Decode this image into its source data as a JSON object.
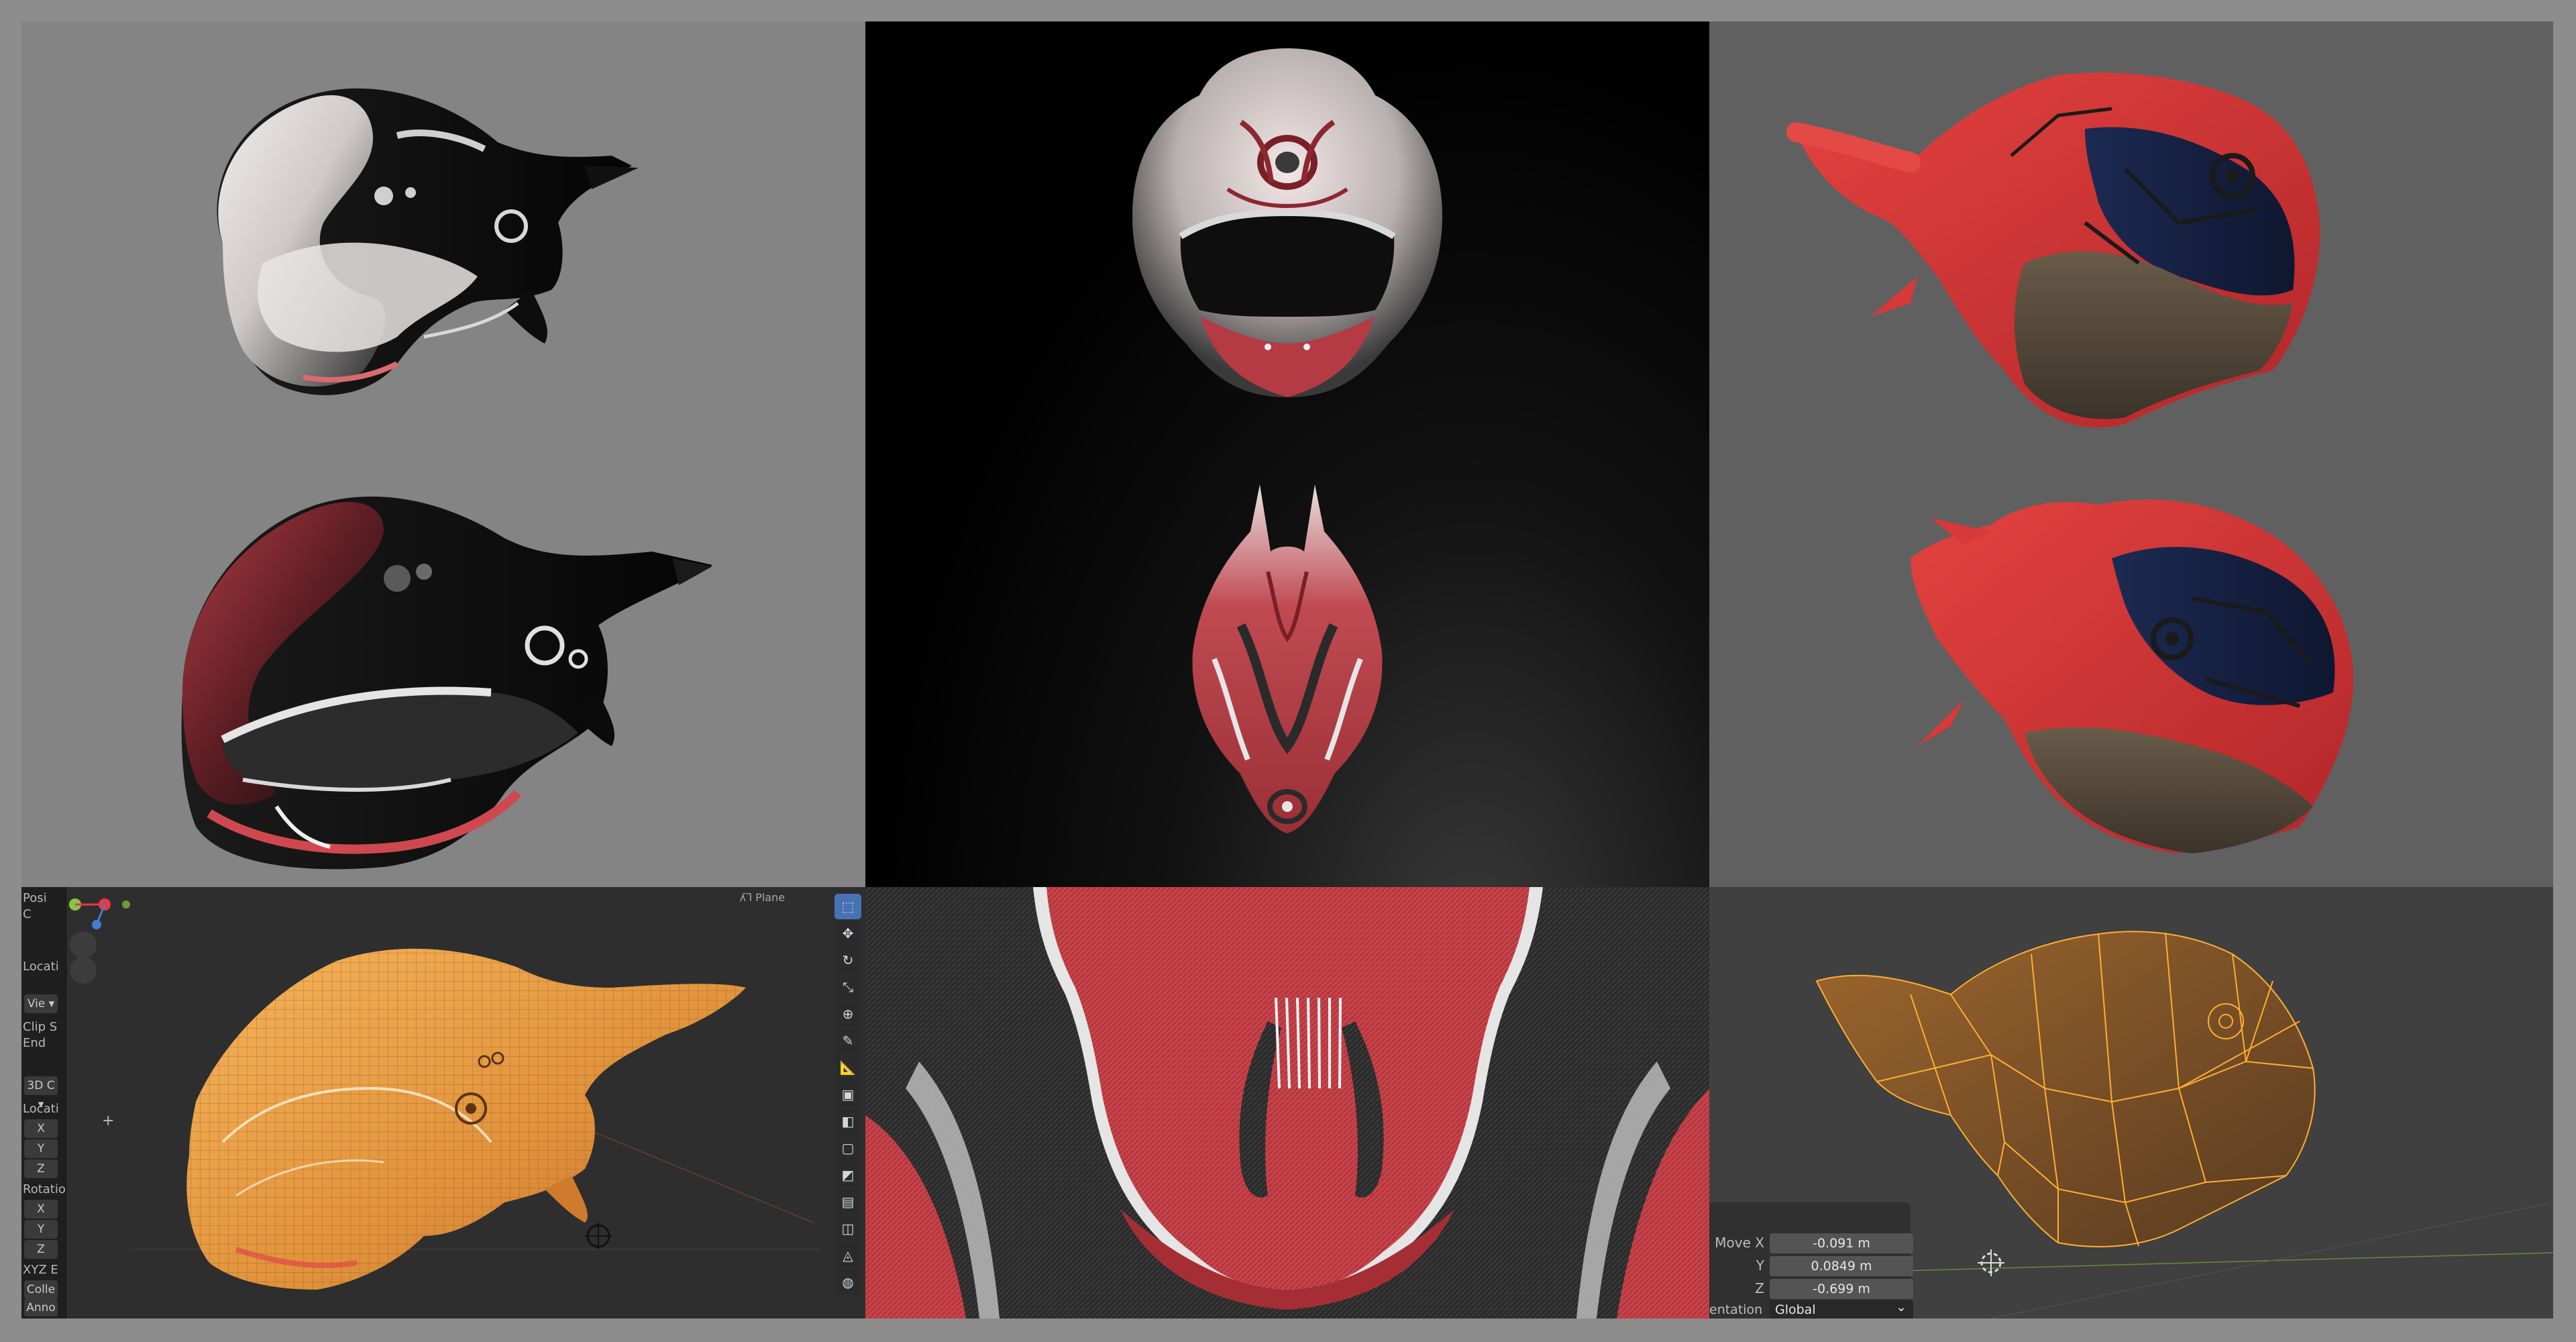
{
  "blender_panel": {
    "header": "ʎ⅂ Plane",
    "left_strip": [
      {
        "type": "text",
        "label": "Posi"
      },
      {
        "type": "text",
        "label": "C"
      },
      {
        "type": "text",
        "label": "Locati"
      },
      {
        "type": "box",
        "label": "Vie ▾"
      },
      {
        "type": "text",
        "label": "Clip S"
      },
      {
        "type": "text",
        "label": "End"
      },
      {
        "type": "box",
        "label": "3D C ▾"
      },
      {
        "type": "text",
        "label": "Locati"
      },
      {
        "type": "box",
        "label": "X"
      },
      {
        "type": "box",
        "label": "Y"
      },
      {
        "type": "box",
        "label": "Z"
      },
      {
        "type": "text",
        "label": "Rotatio"
      },
      {
        "type": "box",
        "label": "X"
      },
      {
        "type": "box",
        "label": "Y"
      },
      {
        "type": "box",
        "label": "Z"
      },
      {
        "type": "text",
        "label": "XYZ E"
      },
      {
        "type": "box",
        "label": "Colle ▾"
      },
      {
        "type": "box",
        "label": "Anno ▾"
      }
    ],
    "tools": [
      {
        "icon": "select-box-icon",
        "glyph": "⬚"
      },
      {
        "icon": "move-icon",
        "glyph": "✥"
      },
      {
        "icon": "rotate-icon",
        "glyph": "↻"
      },
      {
        "icon": "scale-icon",
        "glyph": "⤡"
      },
      {
        "icon": "transform-icon",
        "glyph": "⊕"
      },
      {
        "icon": "annotate-icon",
        "glyph": "✎"
      },
      {
        "icon": "measure-icon",
        "glyph": "📐"
      },
      {
        "icon": "add-cube-icon",
        "glyph": "▣"
      },
      {
        "icon": "extrude-icon",
        "glyph": "◧"
      },
      {
        "icon": "inset-icon",
        "glyph": "▢"
      },
      {
        "icon": "bevel-icon",
        "glyph": "◩"
      },
      {
        "icon": "loop-cut-icon",
        "glyph": "▤"
      },
      {
        "icon": "knife-icon",
        "glyph": "◫"
      },
      {
        "icon": "poly-build-icon",
        "glyph": "◬"
      },
      {
        "icon": "spin-icon",
        "glyph": "◍"
      },
      {
        "icon": "smooth-icon",
        "glyph": "◎"
      },
      {
        "icon": "shrink-icon",
        "glyph": "▥"
      }
    ]
  },
  "move_panel": {
    "rows": [
      {
        "label": "Move X",
        "value": "-0.091 m"
      },
      {
        "label": "Y",
        "value": "0.0849 m"
      },
      {
        "label": "Z",
        "value": "-0.699 m"
      }
    ],
    "orientation_label": "entation",
    "orientation_value": "Global",
    "orientation_chevron": "⌄"
  },
  "colors": {
    "carbon_red": "#c9434a",
    "helmet_red_bright": "#d5343a",
    "select_orange": "#f29a2e",
    "blender_active_tool": "#4772b3"
  }
}
